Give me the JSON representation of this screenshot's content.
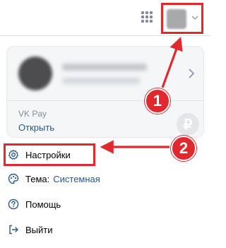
{
  "header": {
    "apps_icon": "grid-icon",
    "avatar_chevron_icon": "chevron-down-icon"
  },
  "account_card": {
    "profile_chevron_icon": "chevron-right-icon",
    "vkpay_label": "VK Pay",
    "vkpay_link": "Открыть",
    "currency_symbol": "₽"
  },
  "menu": {
    "settings_label": "Настройки",
    "theme_label": "Тема:",
    "theme_value": "Системная",
    "help_label": "Помощь",
    "logout_label": "Выйти"
  },
  "annotations": {
    "step1": "1",
    "step2": "2",
    "highlight_color": "#e0282f"
  }
}
